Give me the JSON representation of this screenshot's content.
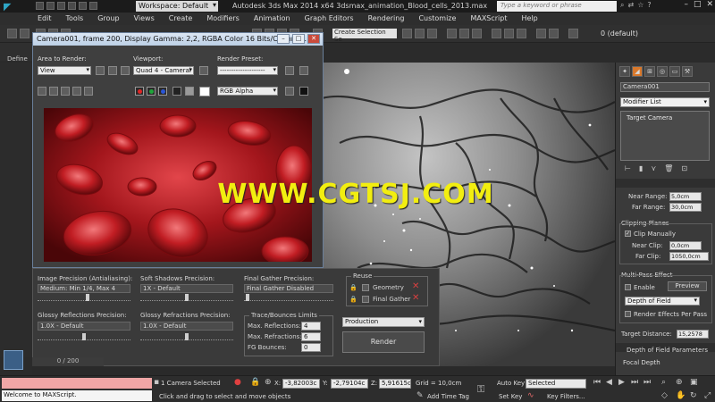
{
  "titlebar": {
    "workspace": "Workspace: Default",
    "title": "Autodesk 3ds Max  2014 x64     3dsmax_animation_Blood_cells_2013.max",
    "search_placeholder": "Type a keyword or phrase"
  },
  "menu": [
    "Edit",
    "Tools",
    "Group",
    "Views",
    "Create",
    "Modifiers",
    "Animation",
    "Graph Editors",
    "Rendering",
    "Customize",
    "MAXScript",
    "Help"
  ],
  "toolbar": {
    "selection_set": "Create Selection Se",
    "layer": "0 (default)",
    "ribbon_label": "Define"
  },
  "render_window": {
    "title": "Camera001, frame 200, Display Gamma: 2,2, RGBA Color 16 Bits/Channel...",
    "area_label": "Area to Render:",
    "area_value": "View",
    "viewport_label": "Viewport:",
    "viewport_value": "Quad 4 - Cameral",
    "preset_label": "Render Preset:",
    "preset_value": "--------------------",
    "channel_value": "RGB Alpha",
    "colors": {
      "red": "#e02424",
      "green": "#1fa53a",
      "blue": "#2a56d8",
      "blood": "#8b1216"
    }
  },
  "render_settings": {
    "image_precision_label": "Image Precision (Antialiasing):",
    "image_precision_value": "Medium: Min 1/4, Max 4",
    "soft_shadows_label": "Soft Shadows Precision:",
    "soft_shadows_value": "1X - Default",
    "final_gather_label": "Final Gather Precision:",
    "final_gather_value": "Final Gather Disabled",
    "reuse_label": "Reuse",
    "geometry_label": "Geometry",
    "final_gather_reuse_label": "Final Gather",
    "glossy_reflections_label": "Glossy Reflections Precision:",
    "glossy_reflections_value": "1.0X - Default",
    "glossy_refractions_label": "Glossy Refractions Precision:",
    "glossy_refractions_value": "1.0X - Default",
    "trace_label": "Trace/Bounces Limits",
    "max_reflections_label": "Max. Reflections:",
    "max_reflections_value": "4",
    "max_refractions_label": "Max. Refractions:",
    "max_refractions_value": "6",
    "fg_bounces_label": "FG Bounces:",
    "fg_bounces_value": "0",
    "production": "Production",
    "render_button": "Render"
  },
  "timeline": {
    "position": "0 / 200"
  },
  "status": {
    "maxscript_text": "Welcome to MAXScript.",
    "selected": "1 Camera Selected",
    "prompt": "Click and drag to select and move objects",
    "x_label": "X:",
    "x_value": "-3,82003c",
    "y_label": "Y:",
    "y_value": "-2,79104c",
    "z_label": "Z:",
    "z_value": "5,91615cn",
    "grid": "Grid = 10,0cm",
    "auto_key": "Auto Key",
    "set_key": "Set Key",
    "key_mode": "Selected",
    "key_filters": "Key Filters...",
    "add_time_tag": "Add Time Tag"
  },
  "command_panel": {
    "object_name": "Camera001",
    "modifier_list": "Modifier List",
    "stack_item": "Target Camera",
    "near_range_label": "Near Range:",
    "near_range_value": "5,0cm",
    "far_range_label": "Far Range:",
    "far_range_value": "30,0cm",
    "clipping_label": "Clipping Planes",
    "clip_manually_label": "Clip Manually",
    "near_clip_label": "Near Clip:",
    "near_clip_value": "0,0cm",
    "far_clip_label": "Far Clip:",
    "far_clip_value": "1050,0cm",
    "multipass_label": "Multi-Pass Effect",
    "enable_label": "Enable",
    "preview_label": "Preview",
    "effect_value": "Depth of Field",
    "render_effects_label": "Render Effects Per Pass",
    "target_distance_label": "Target Distance:",
    "target_distance_value": "15,2578",
    "dof_params_label": "Depth of Field Parameters",
    "focal_depth_label": "Focal Depth"
  },
  "watermark": "WWW.CGTSJ.COM"
}
